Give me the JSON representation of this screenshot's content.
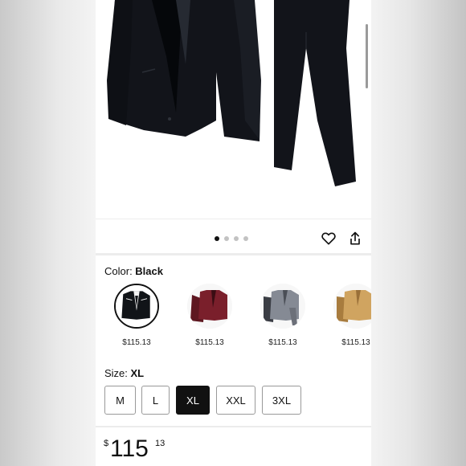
{
  "gallery": {
    "image_name": "black-suit-photo",
    "dot_count": 4,
    "active_dot": 0,
    "icons": {
      "favorite": "heart-icon",
      "share": "share-icon"
    }
  },
  "color": {
    "label": "Color: ",
    "selected": "Black",
    "options": [
      {
        "swatch_color": "#111418",
        "price": "$115.13"
      },
      {
        "swatch_color": "#6b1a24",
        "price": "$115.13"
      },
      {
        "swatch_color": "#7b7f88",
        "price": "$115.13"
      },
      {
        "swatch_color": "#c79a55",
        "price": "$115.13"
      }
    ]
  },
  "size": {
    "label": "Size: ",
    "selected": "XL",
    "options": [
      "M",
      "L",
      "XL",
      "XXL",
      "3XL"
    ]
  },
  "price": {
    "currency": "$",
    "whole": "115",
    "fraction": "13"
  }
}
